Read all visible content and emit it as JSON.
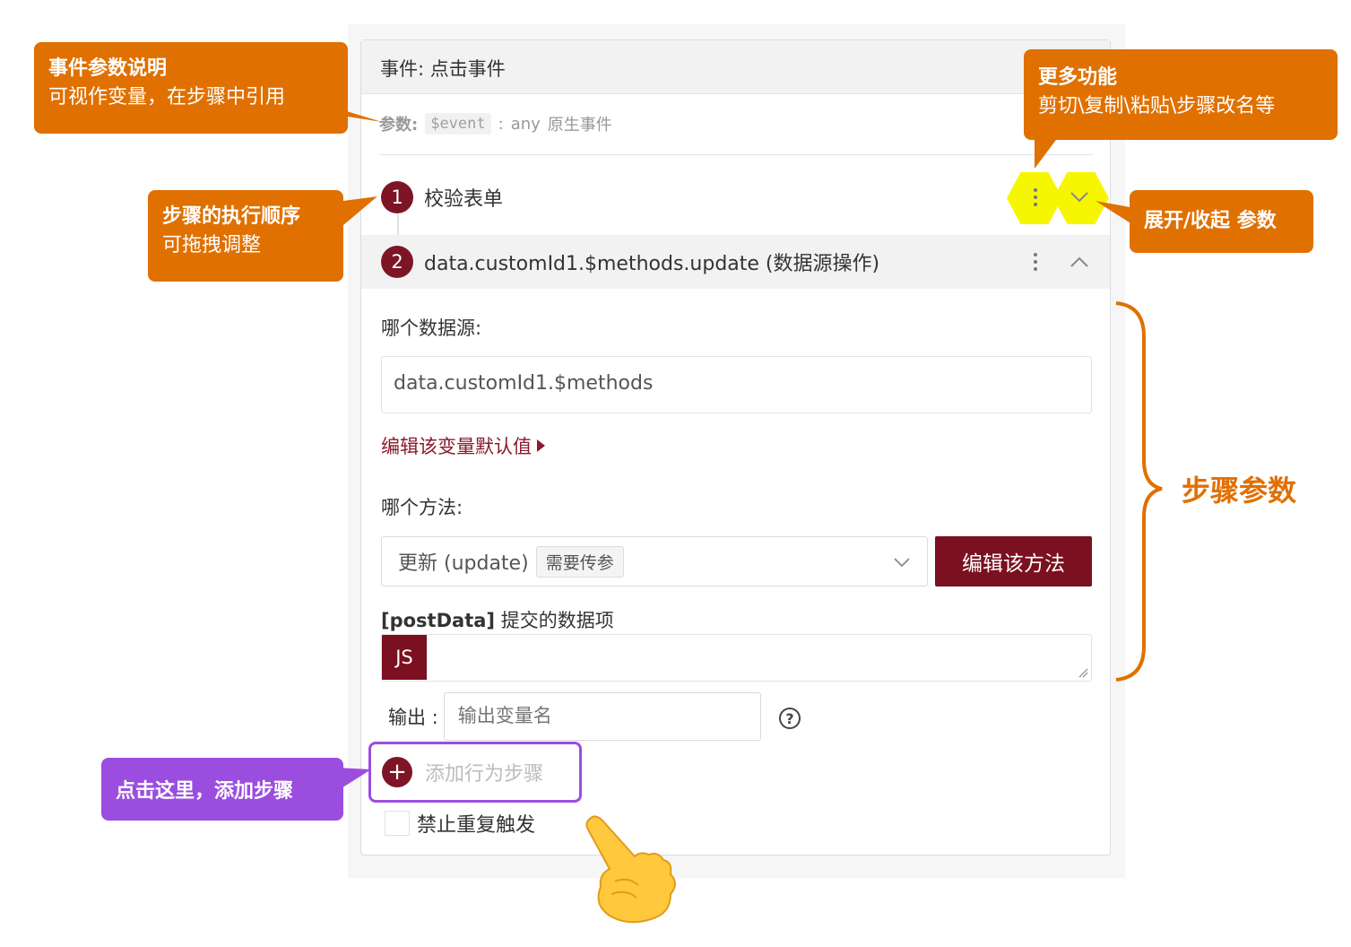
{
  "panel": {
    "header": "事件: 点击事件",
    "params_key": "参数:",
    "params_var": "$event",
    "params_colon": ":",
    "params_type": "any",
    "params_desc": "原生事件"
  },
  "steps": [
    {
      "number": "1",
      "label": "校验表单"
    },
    {
      "number": "2",
      "label": "data.customId1.$methods.update (数据源操作)"
    }
  ],
  "step_params": {
    "datasource_label": "哪个数据源:",
    "datasource_value": "data.customId1.$methods",
    "edit_default_link": "编辑该变量默认值",
    "method_label": "哪个方法:",
    "method_value": "更新 (update)",
    "method_tag": "需要传参",
    "edit_method_button": "编辑该方法",
    "postdata_key": "[postData]",
    "postdata_desc": "提交的数据项",
    "js_badge": "JS",
    "output_label": "输出 :",
    "output_placeholder": "输出变量名",
    "help_glyph": "?"
  },
  "add_step": {
    "plus_glyph": "+",
    "label": "添加行为步骤"
  },
  "no_repeat": {
    "label": "禁止重复触发"
  },
  "annotations": {
    "event_params": {
      "title": "事件参数说明",
      "body": "可视作变量，在步骤中引用"
    },
    "step_order": {
      "title": "步骤的执行顺序",
      "body": "可拖拽调整"
    },
    "more_functions": {
      "title": "更多功能",
      "body": "剪切\\复制\\粘贴\\步骤改名等"
    },
    "expand_collapse": {
      "title": "展开/收起 参数"
    },
    "step_params": {
      "title": "步骤参数"
    },
    "click_here": {
      "title": "点击这里，添加步骤"
    }
  },
  "colors": {
    "brand": "#7a1020",
    "callout_orange": "#e07000",
    "callout_purple": "#9b4de0",
    "highlight_yellow": "#f6f600"
  },
  "icons": [
    "more-vertical-icon",
    "chevron-down-icon",
    "chevron-up-icon",
    "caret-right-icon",
    "help-circle-icon",
    "plus-icon",
    "pointing-hand-icon",
    "resize-grip-icon"
  ]
}
